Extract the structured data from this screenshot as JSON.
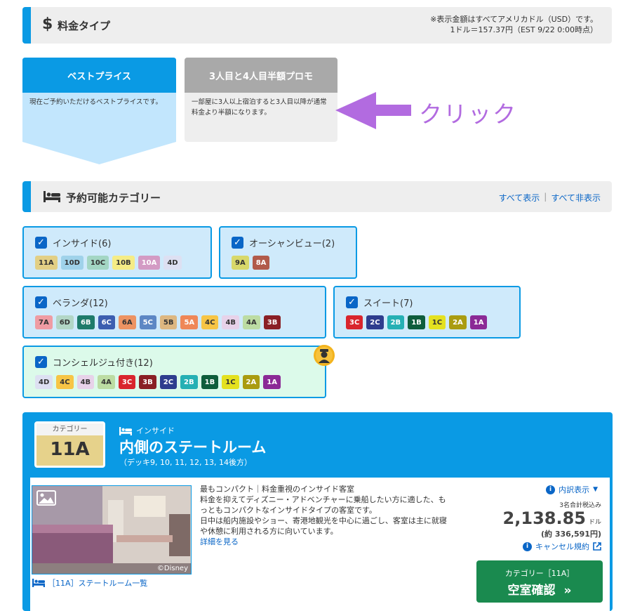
{
  "price_type": {
    "icon": "dollar-icon",
    "title": "料金タイプ",
    "note_line1": "※表示金額はすべてアメリカドル（USD）です。",
    "note_line2": "1ドル＝157.37円（EST 9/22 0:00時点）"
  },
  "tabs": [
    {
      "label": "ベストプライス",
      "desc": "現在ご予約いただけるベストプライスです。"
    },
    {
      "label": "3人目と4人目半額プロモ",
      "desc": "一部屋に3人以上宿泊すると3人目以降が通常料金より半額になります。"
    }
  ],
  "annotation": {
    "text": "クリック",
    "color": "#b26be0"
  },
  "categories_section": {
    "icon": "bed-icon",
    "title": "予約可能カテゴリー",
    "show_all": "すべて表示",
    "separator": "|",
    "hide_all": "すべて非表示"
  },
  "category_groups": [
    {
      "label": "インサイド(6)",
      "chips": [
        {
          "t": "11A",
          "bg": "#e2cf85",
          "fg": "#333"
        },
        {
          "t": "10D",
          "bg": "#9fd2ea",
          "fg": "#333"
        },
        {
          "t": "10C",
          "bg": "#a3d6c4",
          "fg": "#333"
        },
        {
          "t": "10B",
          "bg": "#f5ec86",
          "fg": "#333"
        },
        {
          "t": "10A",
          "bg": "#d39bc4",
          "fg": "#fff"
        },
        {
          "t": "4D",
          "bg": "#dde0f2",
          "fg": "#333"
        }
      ]
    },
    {
      "label": "オーシャンビュー(2)",
      "chips": [
        {
          "t": "9A",
          "bg": "#d8d86a",
          "fg": "#333"
        },
        {
          "t": "8A",
          "bg": "#b15a4a",
          "fg": "#fff"
        }
      ]
    },
    {
      "label": "ベランダ(12)",
      "chips": [
        {
          "t": "7A",
          "bg": "#ef9ca3",
          "fg": "#333"
        },
        {
          "t": "6D",
          "bg": "#b2d6c6",
          "fg": "#333"
        },
        {
          "t": "6B",
          "bg": "#1e7b6a",
          "fg": "#fff"
        },
        {
          "t": "6C",
          "bg": "#3c5eb0",
          "fg": "#fff"
        },
        {
          "t": "6A",
          "bg": "#ed9362",
          "fg": "#333"
        },
        {
          "t": "5C",
          "bg": "#5d87c4",
          "fg": "#fff"
        },
        {
          "t": "5B",
          "bg": "#ddb781",
          "fg": "#333"
        },
        {
          "t": "5A",
          "bg": "#ef8757",
          "fg": "#fff"
        },
        {
          "t": "4C",
          "bg": "#f7c545",
          "fg": "#333"
        },
        {
          "t": "4B",
          "bg": "#e7d2e9",
          "fg": "#333"
        },
        {
          "t": "4A",
          "bg": "#bcdca3",
          "fg": "#333"
        },
        {
          "t": "3B",
          "bg": "#8a1f25",
          "fg": "#fff"
        }
      ]
    },
    {
      "label": "スイート(7)",
      "chips": [
        {
          "t": "3C",
          "bg": "#d9252d",
          "fg": "#fff"
        },
        {
          "t": "2C",
          "bg": "#2e3d8e",
          "fg": "#fff"
        },
        {
          "t": "2B",
          "bg": "#25b0b4",
          "fg": "#fff"
        },
        {
          "t": "1B",
          "bg": "#0e5d3c",
          "fg": "#fff"
        },
        {
          "t": "1C",
          "bg": "#e4e11f",
          "fg": "#333"
        },
        {
          "t": "2A",
          "bg": "#aa9c10",
          "fg": "#fff"
        },
        {
          "t": "1A",
          "bg": "#8b2a96",
          "fg": "#fff"
        }
      ]
    },
    {
      "label": "コンシェルジュ付き(12)",
      "chips": [
        {
          "t": "4D",
          "bg": "#dde0f2",
          "fg": "#333"
        },
        {
          "t": "4C",
          "bg": "#f7c545",
          "fg": "#333"
        },
        {
          "t": "4B",
          "bg": "#e7d2e9",
          "fg": "#333"
        },
        {
          "t": "4A",
          "bg": "#bcdca3",
          "fg": "#333"
        },
        {
          "t": "3C",
          "bg": "#d9252d",
          "fg": "#fff"
        },
        {
          "t": "3B",
          "bg": "#8a1f25",
          "fg": "#fff"
        },
        {
          "t": "2C",
          "bg": "#2e3d8e",
          "fg": "#fff"
        },
        {
          "t": "2B",
          "bg": "#25b0b4",
          "fg": "#fff"
        },
        {
          "t": "1B",
          "bg": "#0e5d3c",
          "fg": "#fff"
        },
        {
          "t": "1C",
          "bg": "#e4e11f",
          "fg": "#333"
        },
        {
          "t": "2A",
          "bg": "#aa9c10",
          "fg": "#fff"
        },
        {
          "t": "1A",
          "bg": "#8b2a96",
          "fg": "#fff"
        }
      ]
    }
  ],
  "room_card": {
    "category_caption": "カテゴリー",
    "category_code": "11A",
    "type_label": "インサイド",
    "room_name": "内側のステートルーム",
    "decks": "（デッキ9, 10, 11, 12, 13, 14後方）",
    "photo_credit": "©Disney",
    "list_link": "［11A］ステートルーム一覧",
    "desc_heading": "最もコンパクト｜料金重視のインサイド客室",
    "desc_line1": "料金を抑えてディズニー・アドベンチャーに乗船したい方に適した、も",
    "desc_line2": "っともコンパクトなインサイドタイプの客室です。",
    "desc_line3": "日中は船内施設やショー、寄港地観光を中心に過ごし、客室は主に就寝",
    "desc_line4": "や休憩に利用される方に向いています。",
    "details_link": "詳細を見る",
    "breakdown_link": "内訳表示",
    "tax_note": "3名合計税込み",
    "price": "2,138.85",
    "currency": "ドル",
    "price_yen": "(約 336,591円)",
    "cancel_link": "キャンセル規約",
    "cta_line1": "カテゴリー［11A］",
    "cta_line2": "空室確認",
    "cta_arrow": "»"
  }
}
